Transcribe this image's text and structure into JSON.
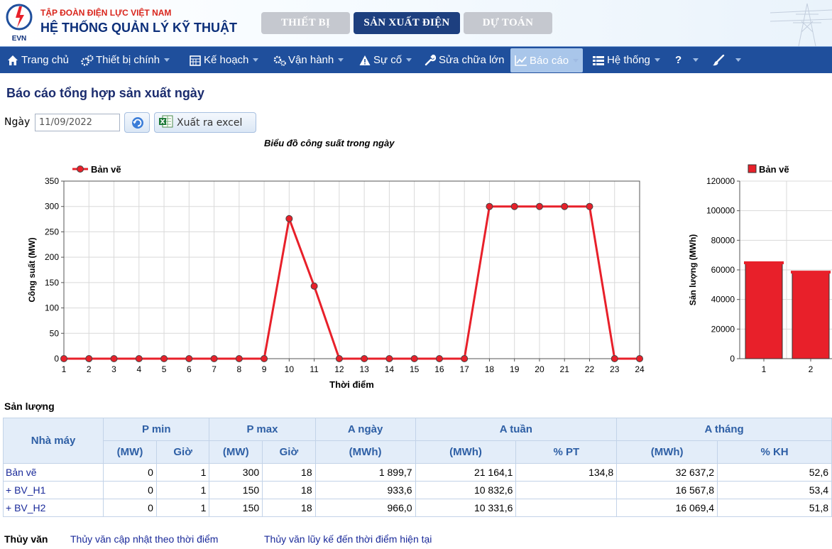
{
  "header": {
    "org_name": "TẬP ĐOÀN ĐIỆN LỰC VIỆT NAM",
    "system_name": "HỆ THỐNG QUẢN LÝ KỸ THUẬT",
    "logo_text": "EVN",
    "tabs": [
      {
        "label": "THIẾT BỊ"
      },
      {
        "label": "SẢN XUẤT ĐIỆN",
        "active": true
      },
      {
        "label": "DỰ TOÁN"
      }
    ]
  },
  "nav": {
    "items": [
      {
        "label": "Trang chủ",
        "icon": "home-icon"
      },
      {
        "label": "Thiết bị chính",
        "icon": "gears-icon"
      },
      {
        "label": "Kế hoạch",
        "icon": "calendar-icon"
      },
      {
        "label": "Vận hành",
        "icon": "cogs-icon"
      },
      {
        "label": "Sự cố",
        "icon": "warning-icon"
      },
      {
        "label": "Sửa chữa lớn",
        "icon": "wrench-icon"
      },
      {
        "label": "Báo cáo",
        "icon": "chart-icon",
        "active": true
      },
      {
        "label": "Hệ thống",
        "icon": "list-icon"
      },
      {
        "label": "?",
        "icon": "help-icon"
      },
      {
        "label": "",
        "icon": "brush-icon"
      }
    ]
  },
  "page": {
    "title": "Báo cáo tổng hợp sản xuất ngày",
    "date_label": "Ngày",
    "date_value": "11/09/2022",
    "export_label": "Xuất ra excel"
  },
  "colors": {
    "series": "#e8202a",
    "brand": "#1f4f9c",
    "header_text": "#0c2f7a"
  },
  "chart_data": [
    {
      "type": "line",
      "title": "Biểu đồ công suất trong ngày",
      "xlabel": "Thời điểm",
      "ylabel": "Công suất (MW)",
      "ylim": [
        0,
        350
      ],
      "yticks": [
        0,
        50,
        100,
        150,
        200,
        250,
        300,
        350
      ],
      "x": [
        1,
        2,
        3,
        4,
        5,
        6,
        7,
        8,
        9,
        10,
        11,
        12,
        13,
        14,
        15,
        16,
        17,
        18,
        19,
        20,
        21,
        22,
        23,
        24
      ],
      "series": [
        {
          "name": "Bản vẽ",
          "values": [
            0,
            0,
            0,
            0,
            0,
            0,
            0,
            0,
            0,
            276,
            143,
            0,
            0,
            0,
            0,
            0,
            0,
            300,
            300,
            300,
            300,
            300,
            0,
            0
          ]
        }
      ],
      "legend": "top-left",
      "grid": true
    },
    {
      "type": "bar",
      "ylabel": "Sản lượng (MWh)",
      "ylim": [
        0,
        120000
      ],
      "yticks": [
        0,
        20000,
        40000,
        60000,
        80000,
        100000,
        120000
      ],
      "categories": [
        "1",
        "2"
      ],
      "series": [
        {
          "name": "Bản vẽ",
          "values": [
            64800,
            58500
          ]
        }
      ],
      "legend": "top-left",
      "grid": true
    }
  ],
  "table": {
    "section_label": "Sản lượng",
    "headers": {
      "plant": "Nhà máy",
      "pmin": "P min",
      "pmax": "P max",
      "aday": "A ngày",
      "aweek": "A tuần",
      "amonth": "A tháng",
      "mw": "(MW)",
      "hour": "Giờ",
      "mwh": "(MWh)",
      "pct_pt": "% PT",
      "pct_kh": "% KH"
    },
    "rows": [
      {
        "name": "Bản vẽ",
        "pmin": "0",
        "pmin_h": "1",
        "pmax": "300",
        "pmax_h": "18",
        "aday": "1 899,7",
        "aweek": "21 164,1",
        "aweek_pct": "134,8",
        "amonth": "32 637,2",
        "amonth_pct": "52,6"
      },
      {
        "name": "+ BV_H1",
        "pmin": "0",
        "pmin_h": "1",
        "pmax": "150",
        "pmax_h": "18",
        "aday": "933,6",
        "aweek": "10 832,6",
        "aweek_pct": "",
        "amonth": "16 567,8",
        "amonth_pct": "53,4"
      },
      {
        "name": "+ BV_H2",
        "pmin": "0",
        "pmin_h": "1",
        "pmax": "150",
        "pmax_h": "18",
        "aday": "966,0",
        "aweek": "10 331,6",
        "aweek_pct": "",
        "amonth": "16 069,4",
        "amonth_pct": "51,8"
      }
    ]
  },
  "footer": {
    "label": "Thủy văn",
    "links": [
      "Thủy văn cập nhật theo thời điểm",
      "Thủy văn lũy kế đến thời điểm hiện tại"
    ]
  }
}
